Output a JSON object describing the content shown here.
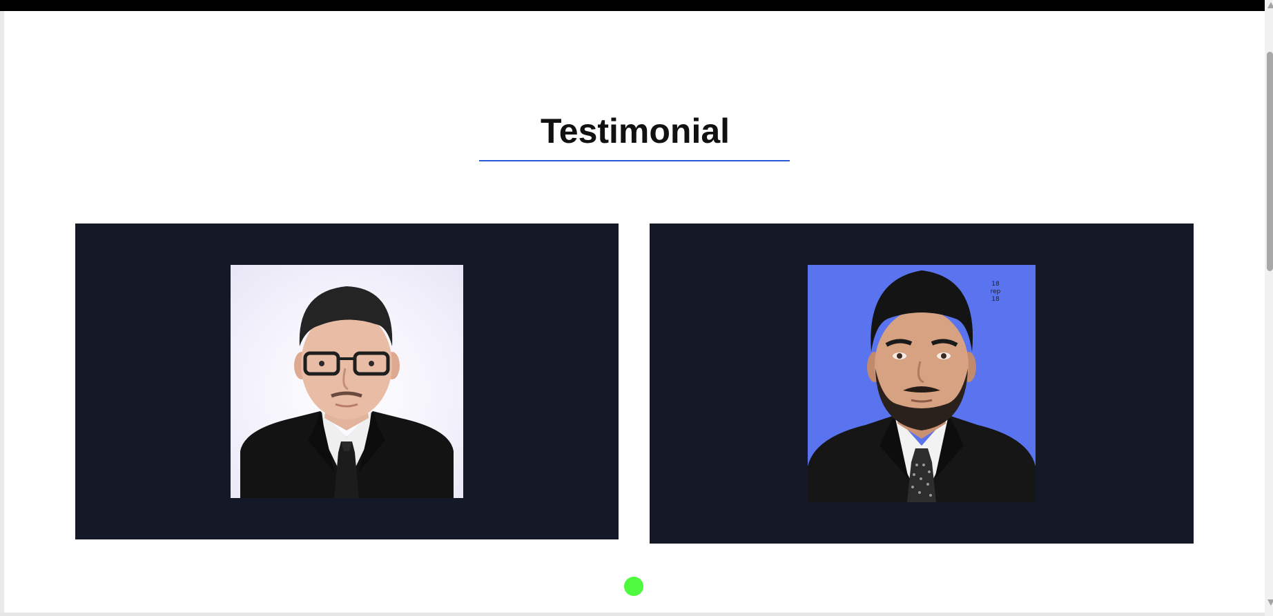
{
  "section": {
    "title": "Testimonial",
    "accent_color": "#2a5bd7"
  },
  "testimonials": [
    {
      "photo_alt": "Young man with glasses in black suit and tie on light background",
      "card_bg": "#151827"
    },
    {
      "photo_alt": "Bearded man in black suit and patterned tie on blue background",
      "card_bg": "#151827",
      "photo_corner_mark": [
        "18",
        "rep",
        "18"
      ]
    }
  ],
  "carousel": {
    "active_dot_color": "#4dfa3e",
    "pages": 1,
    "active_page": 1
  }
}
